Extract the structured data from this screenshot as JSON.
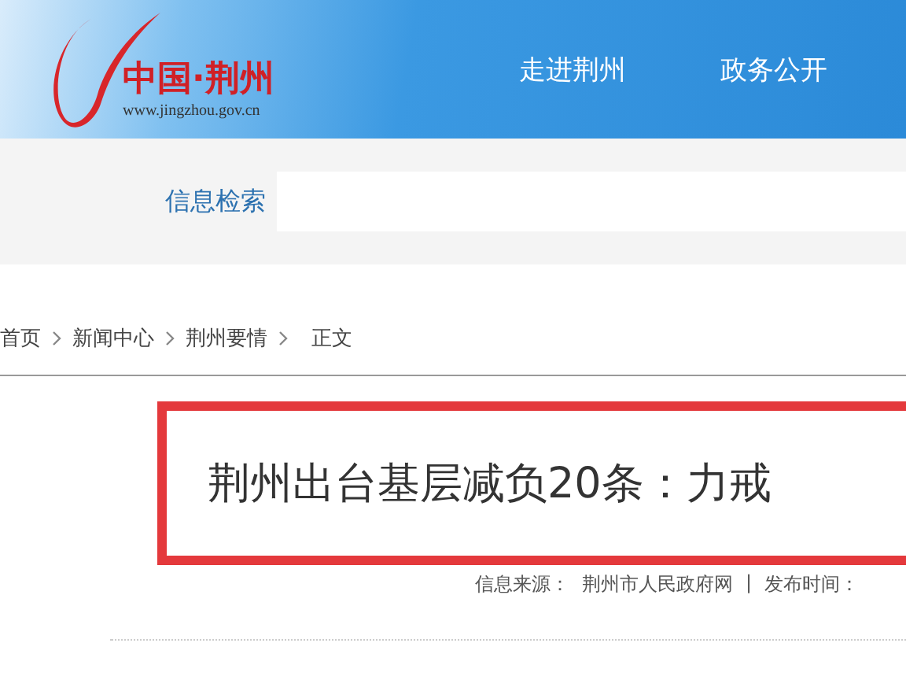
{
  "header": {
    "logo_title": "中国·荆州",
    "logo_url": "www.jingzhou.gov.cn",
    "nav": [
      "走进荆州",
      "政务公开"
    ]
  },
  "search": {
    "label": "信息检索"
  },
  "breadcrumb": [
    "首页",
    "新闻中心",
    "荆州要情",
    "正文"
  ],
  "article": {
    "title": "荆州出台基层减负20条：力戒",
    "meta": [
      "信息来源：",
      "荆州市人民政府网",
      "|",
      "发布时间："
    ]
  }
}
